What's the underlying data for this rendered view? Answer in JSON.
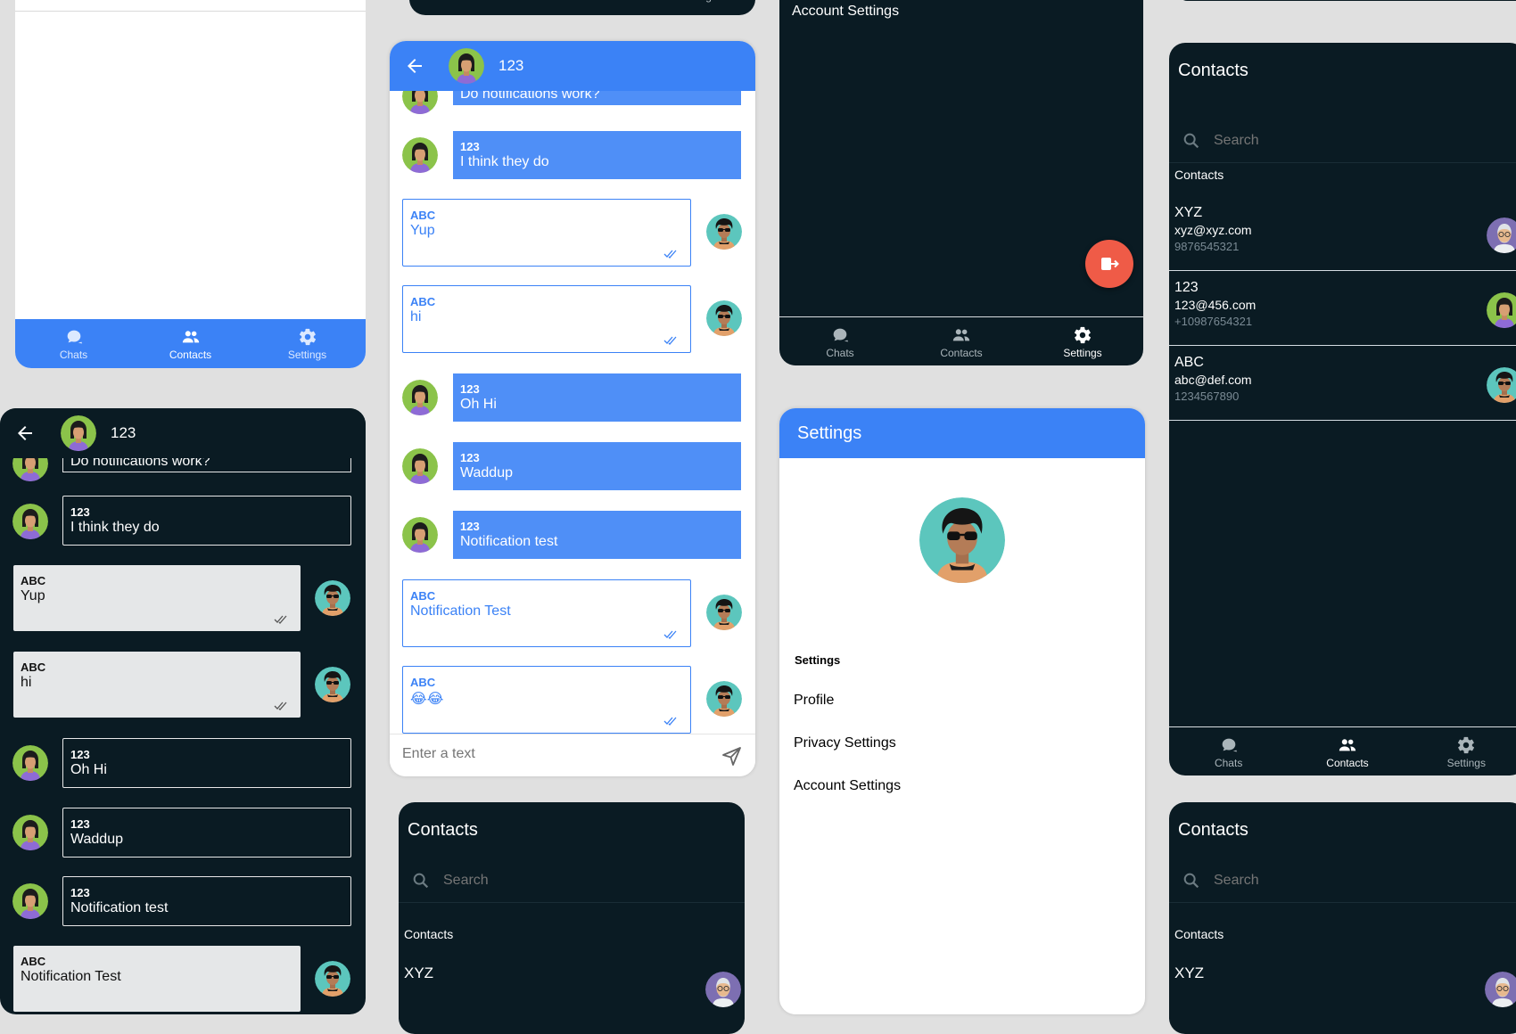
{
  "nav": {
    "chats": "Chats",
    "contacts": "Contacts",
    "settings": "Settings"
  },
  "chat": {
    "contact_name": "123",
    "input_placeholder": "Enter a text",
    "partial_message": "Do notifications work?",
    "messages": [
      {
        "sender": "123",
        "text": "I think they do"
      },
      {
        "sender": "ABC",
        "text": "Yup"
      },
      {
        "sender": "ABC",
        "text": "hi"
      },
      {
        "sender": "123",
        "text": "Oh Hi"
      },
      {
        "sender": "123",
        "text": "Waddup"
      },
      {
        "sender": "123",
        "text": "Notification test"
      },
      {
        "sender": "ABC",
        "text": "Notification Test"
      },
      {
        "sender": "ABC",
        "text": "😂😂"
      }
    ]
  },
  "contacts": {
    "title": "Contacts",
    "search_placeholder": "Search",
    "section_label": "Contacts",
    "items": [
      {
        "name": "XYZ",
        "email": "xyz@xyz.com",
        "phone": "9876545321"
      },
      {
        "name": "123",
        "email": "123@456.com",
        "phone": "+10987654321"
      },
      {
        "name": "ABC",
        "email": "abc@def.com",
        "phone": "1234567890"
      }
    ]
  },
  "settings": {
    "title": "Settings",
    "section_label": "Settings",
    "items": [
      "Profile",
      "Privacy Settings",
      "Account Settings"
    ],
    "top_label": "Account Settings"
  },
  "colors": {
    "primary": "#3b82f6",
    "dark_bg": "#0a1b23",
    "fab": "#ef5b47",
    "dark_bubble": "#e5e7e8"
  }
}
